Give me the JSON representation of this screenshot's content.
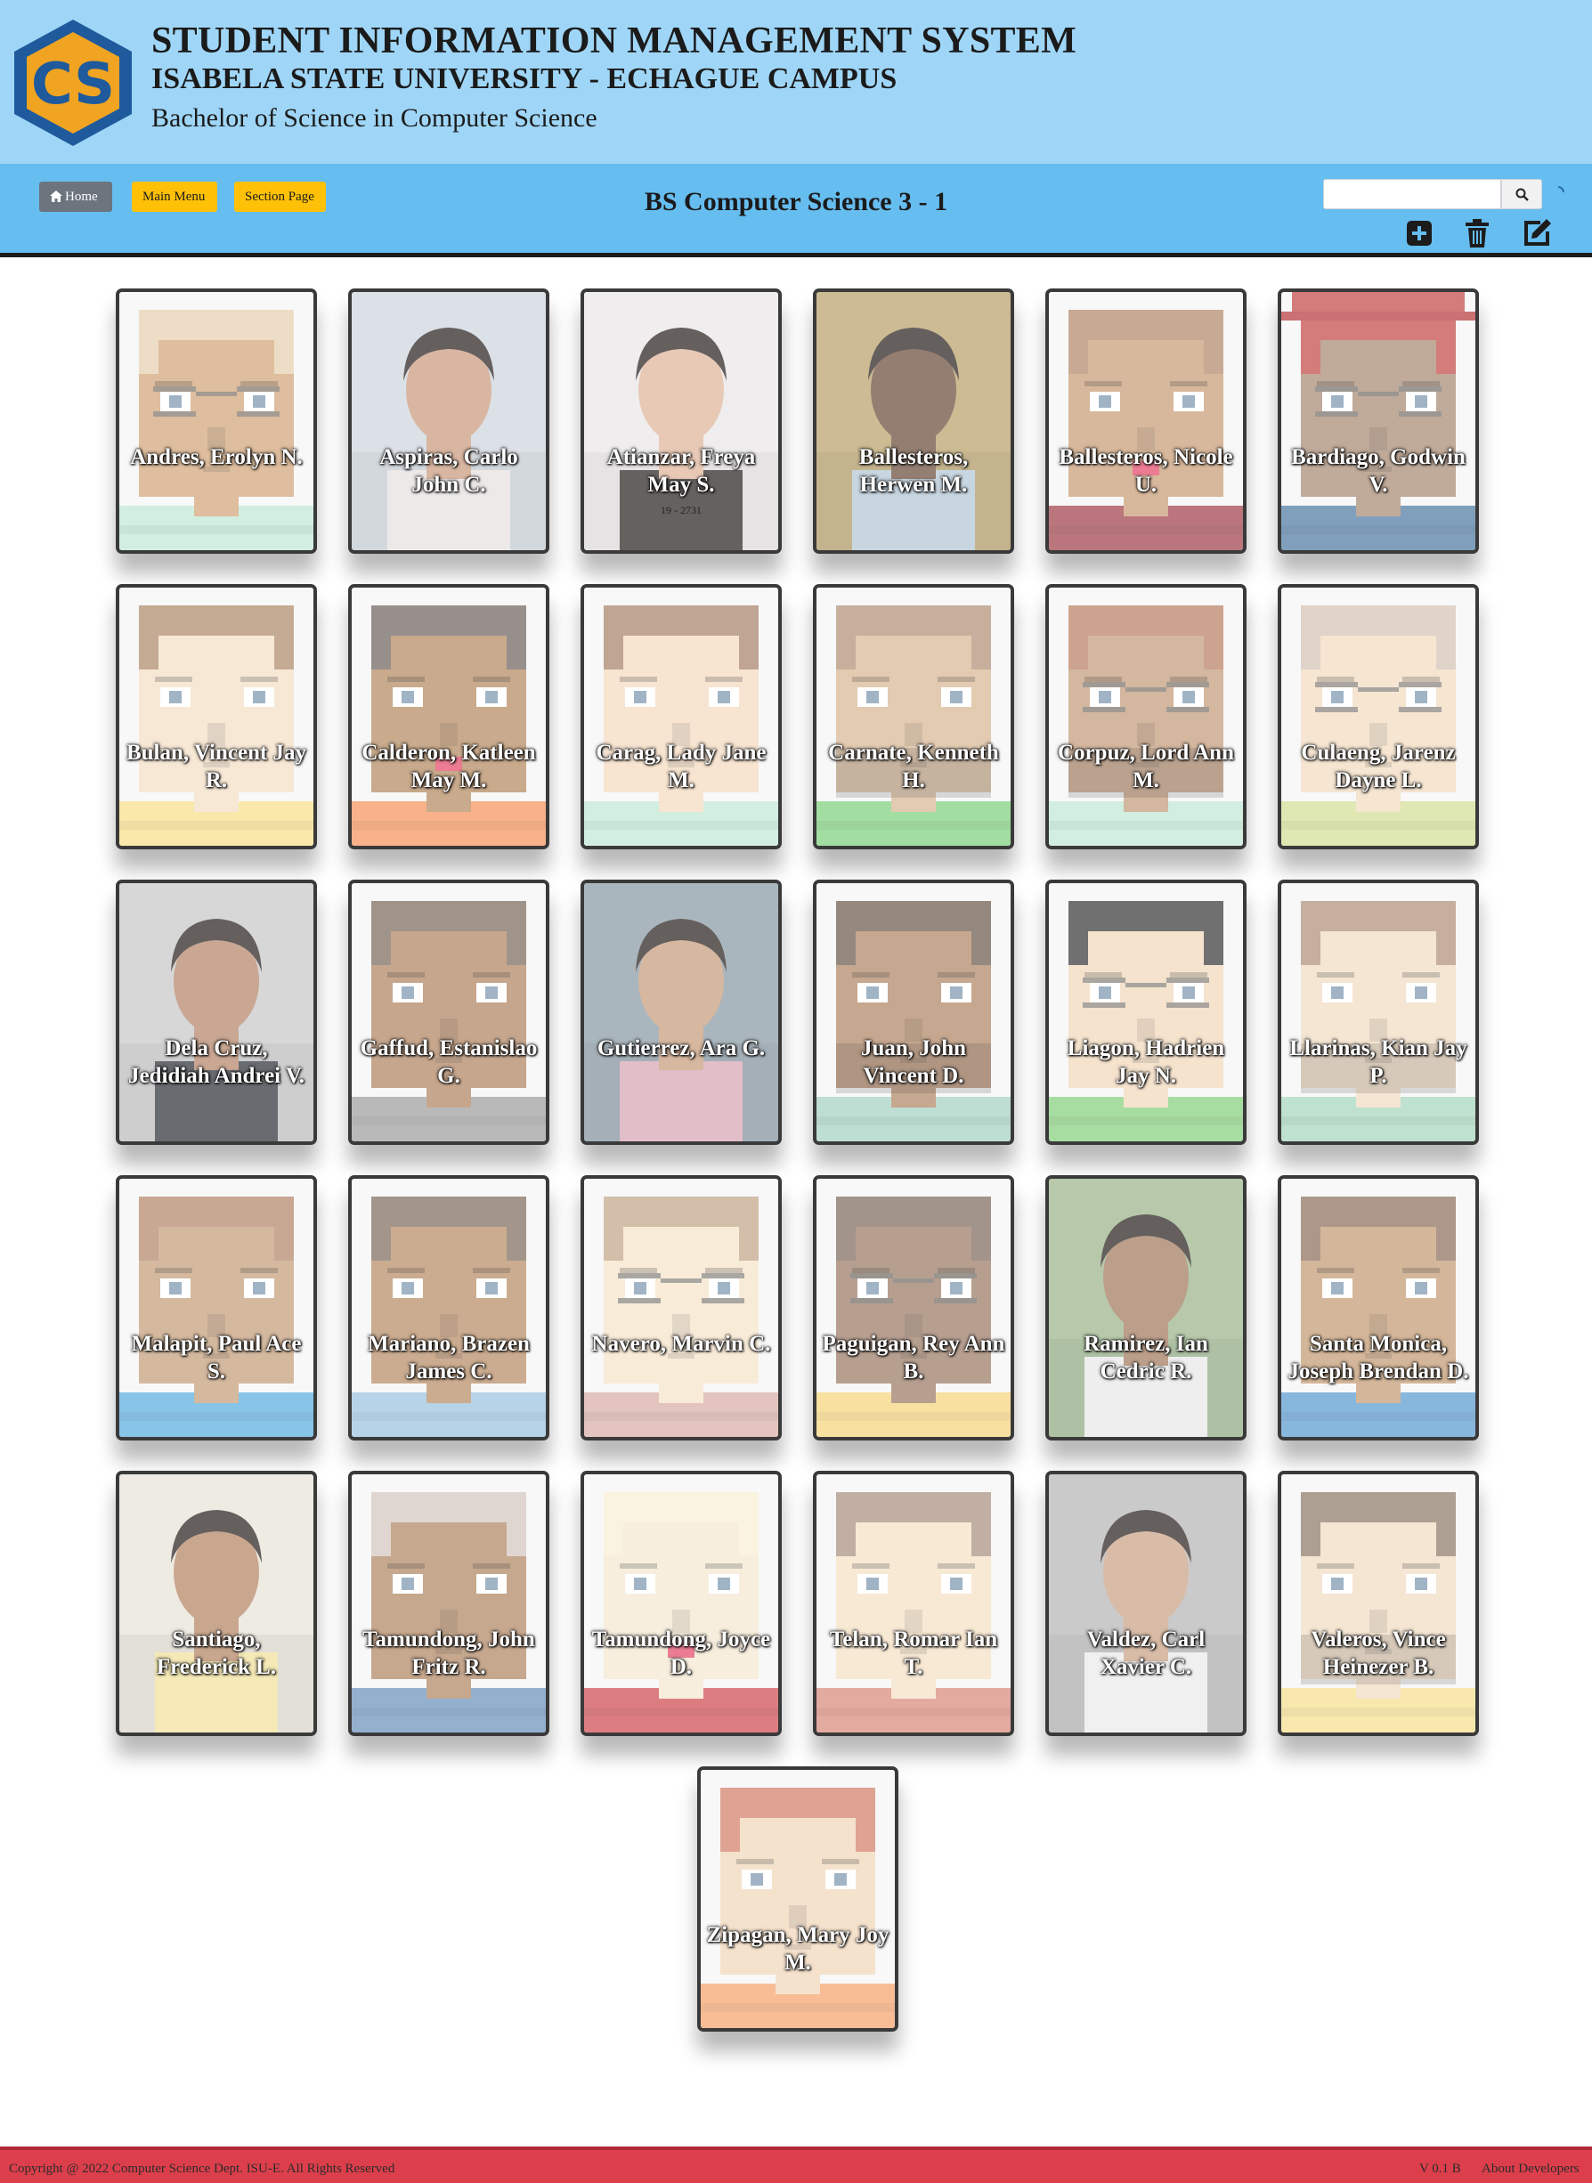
{
  "header": {
    "title": "STUDENT INFORMATION MANAGEMENT SYSTEM",
    "university": "ISABELA STATE UNIVERSITY - ECHAGUE CAMPUS",
    "program": "Bachelor of Science in Computer Science",
    "logo_text": "CS"
  },
  "nav": {
    "home_label": "Home",
    "main_menu_label": "Main Menu",
    "section_page_label": "Section Page",
    "section_title": "BS Computer Science 3 - 1",
    "search_placeholder": "",
    "icons": [
      "home-icon",
      "search-icon",
      "add-icon",
      "trash-icon",
      "edit-icon"
    ]
  },
  "students": [
    {
      "name": "Andres, Erolyn N.",
      "photo": "avatar",
      "skin": "#d2a679",
      "hair": "#e8d0b0",
      "shirt": "#bfe8d4",
      "glasses": true
    },
    {
      "name": "Aspiras, Carlo John C.",
      "photo": "photo",
      "bg": "#cfd6de",
      "skin": "#c99a7d",
      "shirt": "#e7e1e1"
    },
    {
      "name": "Atianzar, Freya May S.",
      "sub": "19 - 2731",
      "photo": "photo",
      "bg": "#e9e6e6",
      "skin": "#e0b59a",
      "shirt": "#2a2422"
    },
    {
      "name": "Ballesteros, Herwen M.",
      "photo": "photo",
      "bg": "#b9a16a",
      "skin": "#6b4d3b",
      "shirt": "#b3c6d6"
    },
    {
      "name": "Ballesteros, Nicole U.",
      "photo": "avatar",
      "skin": "#c99d77",
      "hair": "#b38a6b",
      "shirt": "#a0424a",
      "lips": true
    },
    {
      "name": "Bardiago, Godwin V.",
      "photo": "avatar",
      "skin": "#a88a73",
      "hair": "#c24a48",
      "shirt": "#4f7aa3",
      "glasses": true,
      "hat": true
    },
    {
      "name": "Bulan, Vincent Jay R.",
      "photo": "avatar",
      "skin": "#f4dfc5",
      "hair": "#b08b6b",
      "shirt": "#f8e08a"
    },
    {
      "name": "Calderon, Katleen May M.",
      "photo": "avatar",
      "skin": "#b58a60",
      "hair": "#6f655f",
      "shirt": "#f5935a",
      "lips": true
    },
    {
      "name": "Carag, Lady Jane M.",
      "photo": "avatar",
      "skin": "#f4dac0",
      "hair": "#a8826b",
      "shirt": "#bfe8d4"
    },
    {
      "name": "Carnate, Kenneth H.",
      "photo": "avatar",
      "skin": "#d8b895",
      "hair": "#b09078",
      "shirt": "#7fd17f",
      "beard": true
    },
    {
      "name": "Corpuz, Lord Ann M.",
      "photo": "avatar",
      "skin": "#c49b7a",
      "hair": "#b98063",
      "shirt": "#bfe8d4",
      "glasses": true,
      "beard": true
    },
    {
      "name": "Culaeng, Jarenz Dayne L.",
      "photo": "avatar",
      "skin": "#f2dcc0",
      "hair": "#d4c3b5",
      "shirt": "#d3df95",
      "glasses": true
    },
    {
      "name": "Dela Cruz, Jedidiah Andrei V.",
      "photo": "photo",
      "bg": "#c8c8c8",
      "skin": "#b4866a",
      "shirt": "#2f323a"
    },
    {
      "name": "Gaffud, Estanislao G.",
      "photo": "avatar",
      "skin": "#b08461",
      "hair": "#7c6a5d",
      "shirt": "#9f9f9f"
    },
    {
      "name": "Gutierrez, Ara G.",
      "photo": "photo",
      "bg": "#8a9aa6",
      "skin": "#c79b7b",
      "shirt": "#d7a6b5"
    },
    {
      "name": "Juan, John Vincent D.",
      "photo": "avatar",
      "skin": "#b08664",
      "hair": "#6d5a4d",
      "shirt": "#a6d1c2",
      "beard": true
    },
    {
      "name": "Liagon, Hadrien Jay N.",
      "photo": "avatar",
      "skin": "#f2d9bb",
      "hair": "#3a3a3a",
      "shirt": "#86d07d",
      "glasses": true
    },
    {
      "name": "Llarinas, Kian Jay P.",
      "photo": "avatar",
      "skin": "#f2dcc2",
      "hair": "#b0907b",
      "shirt": "#a6d7bd",
      "beard": true
    },
    {
      "name": "Malapit, Paul Ace S.",
      "photo": "avatar",
      "skin": "#c49e7a",
      "hair": "#b4876a",
      "shirt": "#5aaee0"
    },
    {
      "name": "Mariano, Brazen James C.",
      "photo": "avatar",
      "skin": "#b88c66",
      "hair": "#806c5e",
      "shirt": "#9cc3df"
    },
    {
      "name": "Navero, Marvin C.",
      "photo": "avatar",
      "skin": "#f5e3c9",
      "hair": "#c2a688",
      "shirt": "#d8aea6",
      "glasses": true
    },
    {
      "name": "Paguigan, Rey Ann B.",
      "photo": "avatar",
      "skin": "#9b7b66",
      "hair": "#7e6a5f",
      "shirt": "#f6d57d",
      "glasses": true
    },
    {
      "name": "Ramirez, Ian Cedric R.",
      "photo": "photo",
      "bg": "#9bb48a",
      "skin": "#a37a5f",
      "shirt": "#e8e8e8"
    },
    {
      "name": "Santa Monica, Joseph Brendan D.",
      "photo": "avatar",
      "skin": "#c49b74",
      "hair": "#8c6f5d",
      "shirt": "#5b9bd1"
    },
    {
      "name": "Santiago, Frederick L.",
      "photo": "photo",
      "bg": "#e7e3d7",
      "skin": "#b48664",
      "shirt": "#f2e19b"
    },
    {
      "name": "Tamundong, John Fritz R.",
      "photo": "avatar",
      "skin": "#b18763",
      "hair": "#d4c6c0",
      "shirt": "#6b92bd"
    },
    {
      "name": "Tamundong, Joyce D.",
      "photo": "avatar",
      "skin": "#f5e8d2",
      "hair": "#f7efd4",
      "shirt": "#cf4b51",
      "lips": true
    },
    {
      "name": "Telan, Romar Ian T.",
      "photo": "avatar",
      "skin": "#f5e1c5",
      "hair": "#a8917f",
      "shirt": "#d98a7c"
    },
    {
      "name": "Valdez, Carl Xavier C.",
      "photo": "photo",
      "bg": "#b6b6b6",
      "skin": "#c9a285",
      "shirt": "#ecebea"
    },
    {
      "name": "Valeros, Vince Heinezer B.",
      "photo": "avatar",
      "skin": "#f2dcc2",
      "hair": "#8f7a6a",
      "shirt": "#f7e08e",
      "beard": true
    },
    {
      "name": "Zipagan, Mary Joy M.",
      "photo": "avatar",
      "skin": "#f2d7ba",
      "hair": "#d3806b",
      "shirt": "#f7a46e"
    }
  ],
  "footer": {
    "copyright": "Copyright @ 2022 Computer Science Dept. ISU-E. All Rights Reserved",
    "version": "V 0.1 B",
    "about": "About Developers"
  },
  "colors": {
    "header_bg": "#9fd6f7",
    "navbar_bg": "#66bdf0",
    "button_yellow": "#ffc107",
    "button_gray": "#6c757d",
    "footer_bg": "#dc3f4b",
    "logo_blue": "#1e5a9c",
    "logo_orange": "#f0a422"
  }
}
